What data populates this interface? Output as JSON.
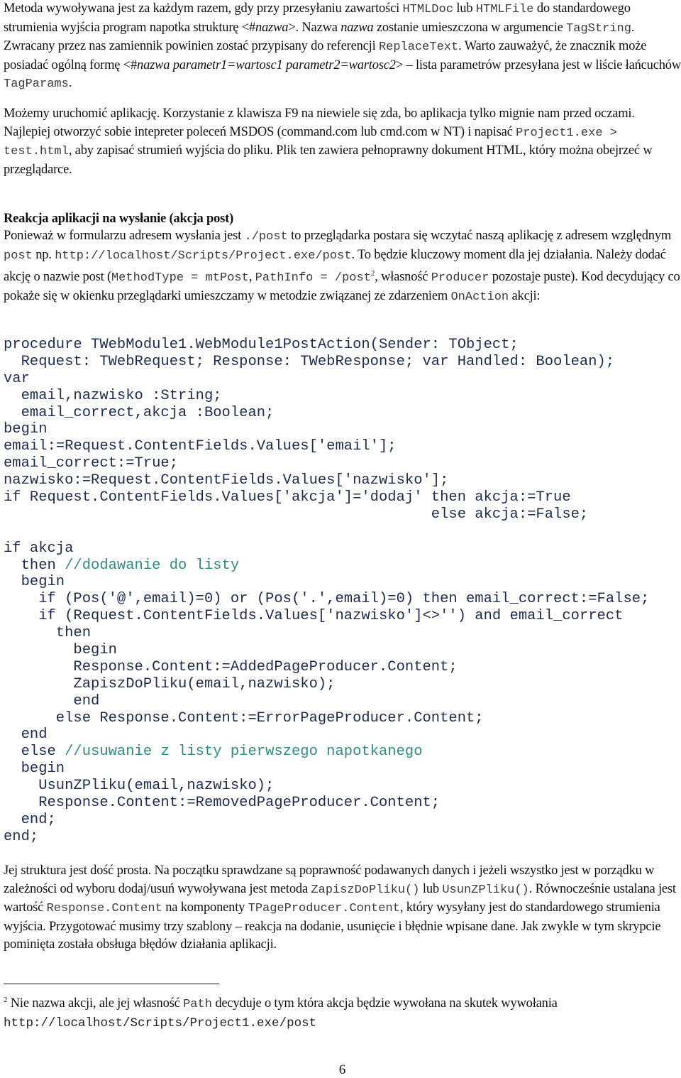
{
  "paragraph1": {
    "t1": "Metoda wywoływana jest za każdym razem, gdy przy przesyłaniu zawartości ",
    "c1": "HTMLDoc",
    "t2": " lub ",
    "c2": "HTMLFile",
    "t3": " do standardowego strumienia wyjścia program napotka strukturę <#",
    "i1": "nazwa",
    "t4": ">. Nazwa ",
    "i2": "nazwa",
    "t5": " zostanie umieszczona w argumencie ",
    "c3": "TagString",
    "t6": ". Zwracany przez nas zamiennik powinien zostać przypisany do referencji ",
    "c4": "ReplaceText",
    "t7": ". Warto zauważyć, że znacznik może posiadać ogólną formę <#",
    "i3": "nazwa parametr1=wartosc1 parametr2=wartosc2",
    "t8": "> – lista parametrów przesyłana jest w liście łańcuchów ",
    "c5": "TagParams",
    "t9": "."
  },
  "paragraph2": {
    "t1": "Możemy uruchomić aplikację. Korzystanie z klawisza F9 na niewiele się zda, bo aplikacja tylko mignie nam przed oczami. Najlepiej otworzyć sobie intepreter poleceń MSDOS (command.com lub cmd.com w NT) i napisać ",
    "c1": "Project1.exe > test.html",
    "t2": ", aby zapisać strumień wyjścia do pliku. Plik ten zawiera pełnoprawny dokument HTML, który można obejrzeć w przeglądarce."
  },
  "section_heading": "Reakcja aplikacji na wysłanie (akcja post)",
  "paragraph3": {
    "t1": "Ponieważ w formularzu adresem wysłania jest ",
    "c1": "./post",
    "t2": " to przeglądarka postara się wczytać naszą aplikację z adresem względnym ",
    "c2": "post",
    "t3": " np. ",
    "c3": "http://localhost/Scripts/Project.exe/post",
    "t4": ". To będzie kluczowy moment dla jej działania. Należy dodać akcję o nazwie post (",
    "c4": "MethodType = mtPost",
    "t5": ", ",
    "c5": "PathInfo = /post",
    "sup": "2",
    "t6": ", własność ",
    "c6": "Producer",
    "t7": " pozostaje puste). Kod decydujący co pokaże się w okienku przeglądarki umieszczamy w metodzie związanej ze zdarzeniem ",
    "c7": "OnAction",
    "t8": " akcji:"
  },
  "code_lines": [
    {
      "code": "procedure TWebModule1.WebModule1PostAction(Sender: TObject;",
      "comment": ""
    },
    {
      "code": "  Request: TWebRequest; Response: TWebResponse; var Handled: Boolean);",
      "comment": ""
    },
    {
      "code": "var",
      "comment": ""
    },
    {
      "code": "  email,nazwisko :String;",
      "comment": ""
    },
    {
      "code": "  email_correct,akcja :Boolean;",
      "comment": ""
    },
    {
      "code": "begin",
      "comment": ""
    },
    {
      "code": "email:=Request.ContentFields.Values['email'];",
      "comment": ""
    },
    {
      "code": "email_correct:=True;",
      "comment": ""
    },
    {
      "code": "nazwisko:=Request.ContentFields.Values['nazwisko'];",
      "comment": ""
    },
    {
      "code": "if Request.ContentFields.Values['akcja']='dodaj' then akcja:=True",
      "comment": ""
    },
    {
      "code": "                                                 else akcja:=False;",
      "comment": ""
    },
    {
      "code": "",
      "comment": ""
    },
    {
      "code": "if akcja",
      "comment": ""
    },
    {
      "code": "  then ",
      "comment": "//dodawanie do listy"
    },
    {
      "code": "  begin",
      "comment": ""
    },
    {
      "code": "    if (Pos('@',email)=0) or (Pos('.',email)=0) then email_correct:=False;",
      "comment": ""
    },
    {
      "code": "    if (Request.ContentFields.Values['nazwisko']<>'') and email_correct",
      "comment": ""
    },
    {
      "code": "      then",
      "comment": ""
    },
    {
      "code": "        begin",
      "comment": ""
    },
    {
      "code": "        Response.Content:=AddedPageProducer.Content;",
      "comment": ""
    },
    {
      "code": "        ZapiszDoPliku(email,nazwisko);",
      "comment": ""
    },
    {
      "code": "        end",
      "comment": ""
    },
    {
      "code": "      else Response.Content:=ErrorPageProducer.Content;",
      "comment": ""
    },
    {
      "code": "  end",
      "comment": ""
    },
    {
      "code": "  else ",
      "comment": "//usuwanie z listy pierwszego napotkanego"
    },
    {
      "code": "  begin",
      "comment": ""
    },
    {
      "code": "    UsunZPliku(email,nazwisko);",
      "comment": ""
    },
    {
      "code": "    Response.Content:=RemovedPageProducer.Content;",
      "comment": ""
    },
    {
      "code": "  end;",
      "comment": ""
    },
    {
      "code": "end;",
      "comment": ""
    }
  ],
  "paragraph4": {
    "t1": "Jej struktura jest dość prosta. Na początku sprawdzane są poprawność podawanych danych i jeżeli wszystko jest w porządku w zależności od wyboru dodaj/usuń wywoływana jest metoda ",
    "c1": "ZapiszDoPliku()",
    "t2": " lub ",
    "c2": "UsunZPliku()",
    "t3": ". Równocześnie ustalana jest wartość ",
    "c3": "Response.Content",
    "t4": " na komponenty ",
    "c4": "TPageProducer.Content",
    "t5": ", który wysyłany jest do standardowego strumienia wyjścia. Przygotować musimy trzy szablony – reakcja na dodanie, usunięcie i błędnie wpisane dane. Jak zwykle w tym skrypcie pominięta została obsługa błędów działania aplikacji."
  },
  "footnote": {
    "number": "2",
    "t1": " Nie nazwa akcji, ale jej własność ",
    "c1": "Path",
    "t2": " decyduje o tym która akcja będzie wywołana na skutek wywołania",
    "url": "http://localhost/Scripts/Project1.exe/post"
  },
  "page_number": "6",
  "colors": {
    "body_text": "#111111",
    "inline_code": "#3a3a3a",
    "code_block": "#1c2b4e",
    "code_comment": "#2f8a82"
  }
}
